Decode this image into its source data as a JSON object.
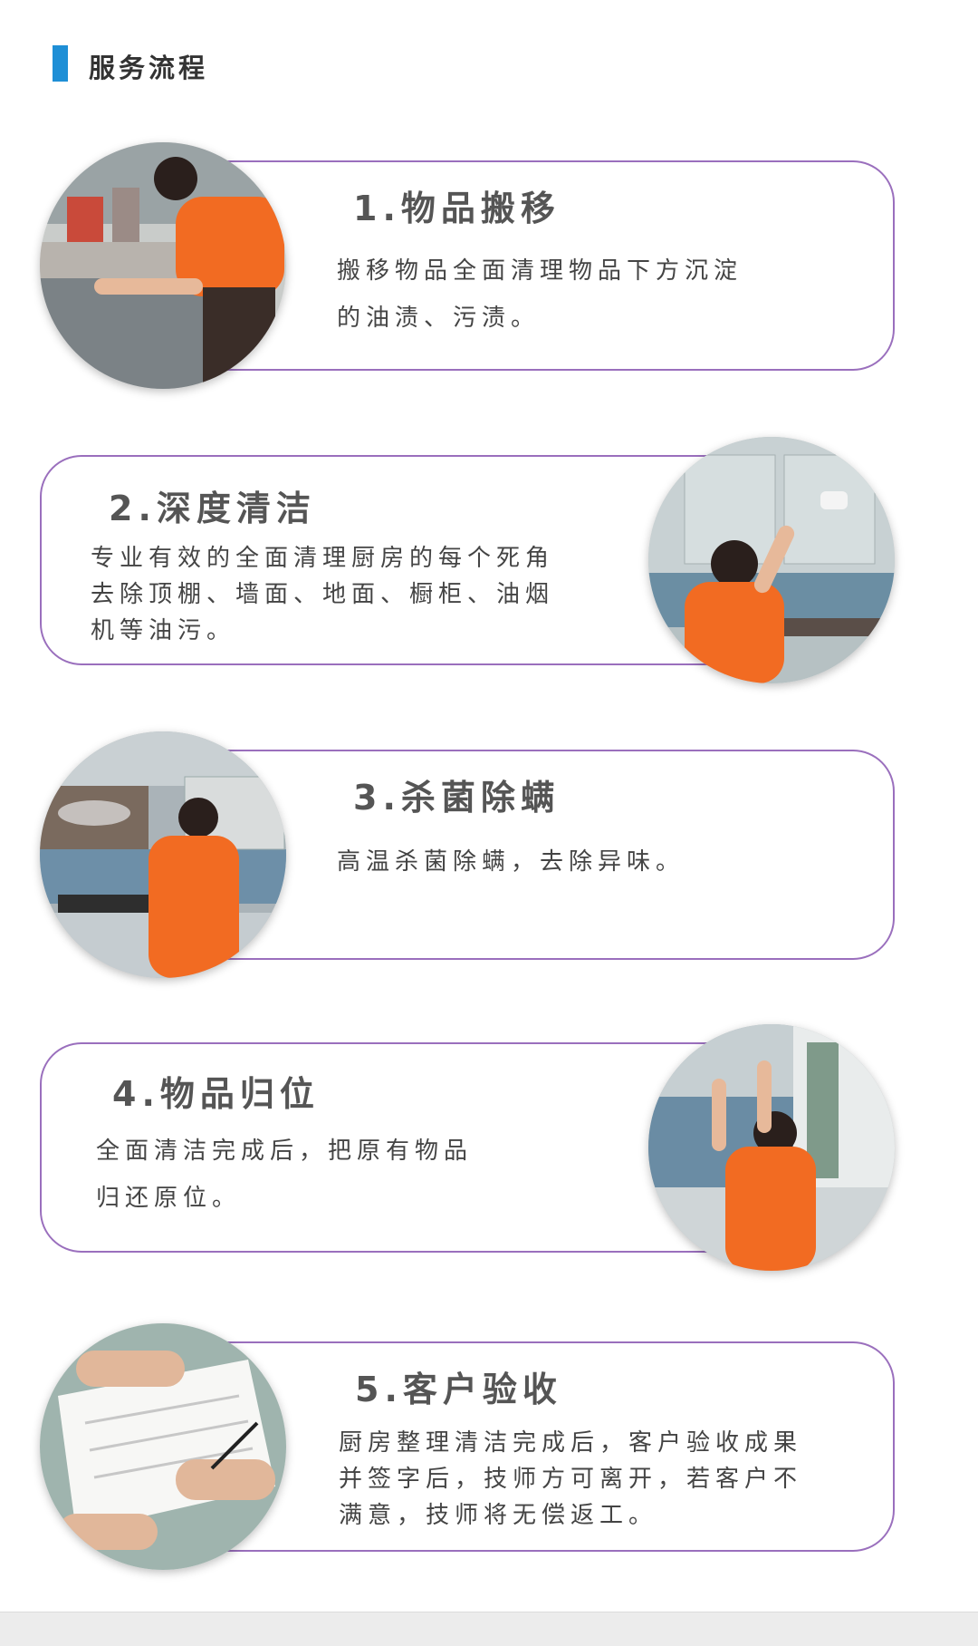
{
  "header": {
    "title": "服务流程",
    "accent_color": "#1f8fd6"
  },
  "card_border_color": "#9a6fbd",
  "steps": [
    {
      "title": "1.物品搬移",
      "lines": [
        "搬移物品全面清理物品下方沉淀",
        "的油渍、污渍。"
      ],
      "photo_icon": "cleaner-moving-items-photo"
    },
    {
      "title": "2.深度清洁",
      "lines": [
        "专业有效的全面清理厨房的每个死角",
        "去除顶棚、墙面、地面、橱柜、油烟",
        "机等油污。"
      ],
      "photo_icon": "cleaner-wiping-cabinet-photo"
    },
    {
      "title": "3.杀菌除螨",
      "lines": [
        "高温杀菌除螨，去除异味。"
      ],
      "photo_icon": "cleaner-steam-sterilizing-photo"
    },
    {
      "title": "4.物品归位",
      "lines": [
        "全面清洁完成后，把原有物品",
        "归还原位。"
      ],
      "photo_icon": "cleaner-restoring-items-photo"
    },
    {
      "title": "5.客户验收",
      "lines": [
        "厨房整理清洁完成后，客户验收成果",
        "并签字后，技师方可离开，若客户不",
        "满意，技师将无偿返工。"
      ],
      "photo_icon": "customer-signing-form-photo"
    }
  ]
}
